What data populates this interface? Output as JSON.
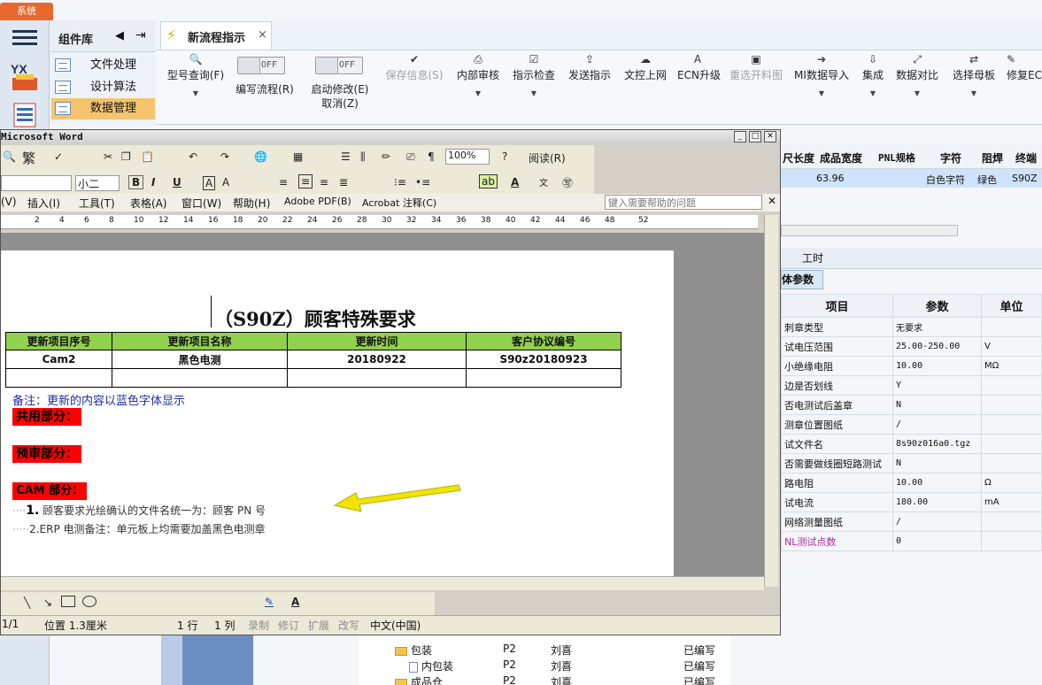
{
  "app": {
    "system_tab": "系统"
  },
  "panel": {
    "title": "组件库",
    "items": [
      "文件处理",
      "设计算法",
      "数据管理"
    ]
  },
  "flow_tab": {
    "label": "新流程指示",
    "close": "×"
  },
  "ribbon": {
    "model_query": "型号查询(F)",
    "edit_flow_toggle": "OFF",
    "edit_flow_label": "编写流程(R)",
    "start_modify_toggle": "OFF",
    "start_modify_label": "启动修改(E)",
    "cancel_label": "取消(Z)",
    "buttons": [
      {
        "label": "保存信息(S)",
        "icon": "check-icon",
        "disabled": true
      },
      {
        "label": "内部审核",
        "icon": "print-icon",
        "disabled": false
      },
      {
        "label": "指示检查",
        "icon": "checkbox-icon",
        "disabled": false
      },
      {
        "label": "发送指示",
        "icon": "upload-icon",
        "disabled": false
      },
      {
        "label": "文控上网",
        "icon": "cloud-upload-icon",
        "disabled": false
      },
      {
        "label": "ECN升级",
        "icon": "bold-a-icon",
        "disabled": false
      },
      {
        "label": "重选开料图",
        "icon": "image-icon",
        "disabled": true
      },
      {
        "label": "MI数据导入",
        "icon": "import-icon",
        "disabled": false
      },
      {
        "label": "集成",
        "icon": "download-icon",
        "disabled": false
      },
      {
        "label": "数据对比",
        "icon": "compare-icon",
        "disabled": false
      },
      {
        "label": "选择母板",
        "icon": "shuffle-icon",
        "disabled": false
      },
      {
        "label": "修复ECN",
        "icon": "wrench-icon",
        "disabled": false
      }
    ]
  },
  "grid": {
    "headers": [
      "尺长度",
      "成品宽度",
      "PNL规格",
      "字符",
      "阻焊",
      "终端"
    ],
    "row": [
      "",
      "63.96",
      "",
      "白色字符",
      "绿色",
      "S90Z"
    ]
  },
  "params": {
    "tabs": [
      "工时"
    ],
    "active_tab": "体参数",
    "headers": [
      "项目",
      "参数",
      "单位"
    ],
    "rows": [
      [
        "刺章类型",
        "无要求",
        ""
      ],
      [
        "试电压范围",
        "25.00-250.00",
        "V"
      ],
      [
        "小绝缘电阻",
        "10.00",
        "MΩ"
      ],
      [
        "边是否划线",
        "Y",
        ""
      ],
      [
        "否电测试后盖章",
        "N",
        ""
      ],
      [
        "测章位置图纸",
        "/",
        ""
      ],
      [
        "试文件名",
        "8s90z016a0.tgz",
        ""
      ],
      [
        "否需要做线圈短路测试",
        "N",
        ""
      ],
      [
        "路电阻",
        "10.00",
        "Ω"
      ],
      [
        "试电流",
        "180.00",
        "mA"
      ],
      [
        "网络测量图纸",
        "/",
        ""
      ],
      [
        "NL测试点数",
        "0",
        ""
      ]
    ]
  },
  "tree": {
    "rows": [
      {
        "name": "包装",
        "type": "folder",
        "code": "P2",
        "person": "刘喜",
        "status": "已编写"
      },
      {
        "name": "内包装",
        "type": "doc",
        "code": "P2",
        "person": "刘喜",
        "status": "已编写"
      },
      {
        "name": "成品仓",
        "type": "folder",
        "code": "P2",
        "person": "刘喜",
        "status": "已编写"
      }
    ]
  },
  "word": {
    "title": "Microsoft Word",
    "font_size": "小二",
    "zoom": "100%",
    "read_mode": "阅读(R)",
    "traditional": "繁",
    "menus": [
      "(V)",
      "插入(I)",
      "工具(T)",
      "表格(A)",
      "窗口(W)",
      "帮助(H)",
      "Adobe PDF(B)",
      "Acrobat 注释(C)"
    ],
    "help_placeholder": "键入需要帮助的问题",
    "ruler_marks": [
      "2",
      "4",
      "6",
      "8",
      "10",
      "12",
      "14",
      "16",
      "18",
      "20",
      "22",
      "24",
      "26",
      "28",
      "30",
      "32",
      "34",
      "36",
      "38",
      "40",
      "42",
      "44",
      "46",
      "48",
      "52"
    ],
    "status": {
      "page": "1/1",
      "position": "位置 1.3厘米",
      "line": "1 行",
      "col": "1 列",
      "rec": "录制",
      "trk": "修订",
      "ext": "扩展",
      "ovr": "改写",
      "lang": "中文(中国)"
    }
  },
  "document": {
    "title": "（S90Z）顾客特殊要求",
    "table_headers": [
      "更新项目序号",
      "更新项目名称",
      "更新时间",
      "客户协议编号"
    ],
    "table_row": [
      "Cam2",
      "黑色电测",
      "20180922",
      "S90z20180923"
    ],
    "note": "备注：更新的内容以蓝色字体显示",
    "section_common": "共用部分：",
    "section_precheck": "预审部分：",
    "section_cam": "CAM 部分：",
    "item1_num": "1.",
    "item1_text": "顾客要求光绘确认的文件名统一为：顾客 PN 号",
    "item2": "2.ERP 电测备注：单元板上均需要加盖黑色电测章"
  },
  "colors": {
    "accent_orange": "#e8682e",
    "table_header_green": "#92d050",
    "label_red": "#ff0000",
    "note_blue": "#1c2ea3",
    "arrow_yellow": "#f0e400"
  }
}
